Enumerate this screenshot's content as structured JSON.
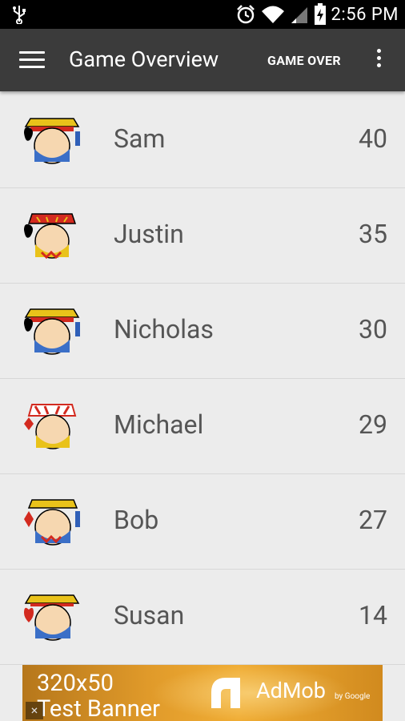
{
  "status_bar": {
    "time": "2:56 PM"
  },
  "app_bar": {
    "title": "Game Overview",
    "action_label": "GAME OVER"
  },
  "players": [
    {
      "name": "Sam",
      "score": "40",
      "card": "king-spades"
    },
    {
      "name": "Justin",
      "score": "35",
      "card": "jack-spades"
    },
    {
      "name": "Nicholas",
      "score": "30",
      "card": "king-spades"
    },
    {
      "name": "Michael",
      "score": "29",
      "card": "jack-diamonds"
    },
    {
      "name": "Bob",
      "score": "27",
      "card": "king-diamonds"
    },
    {
      "name": "Susan",
      "score": "14",
      "card": "king-hearts"
    }
  ],
  "ad": {
    "line1": "320x50",
    "line2": "Test Banner",
    "brand": "AdMob",
    "by": "by Google",
    "close": "×"
  }
}
